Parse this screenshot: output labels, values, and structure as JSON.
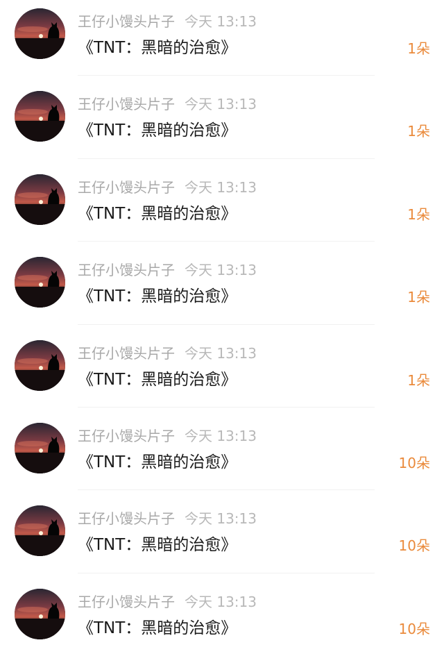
{
  "avatar_icon": "avatar-sunset-silhouette",
  "accent_color": "#ea8a3b",
  "items": [
    {
      "username": "王仔小馒头片子",
      "time": "今天 13:13",
      "title": "《TNT：黑暗的治愈》",
      "count": "1朵"
    },
    {
      "username": "王仔小馒头片子",
      "time": "今天 13:13",
      "title": "《TNT：黑暗的治愈》",
      "count": "1朵"
    },
    {
      "username": "王仔小馒头片子",
      "time": "今天 13:13",
      "title": "《TNT：黑暗的治愈》",
      "count": "1朵"
    },
    {
      "username": "王仔小馒头片子",
      "time": "今天 13:13",
      "title": "《TNT：黑暗的治愈》",
      "count": "1朵"
    },
    {
      "username": "王仔小馒头片子",
      "time": "今天 13:13",
      "title": "《TNT：黑暗的治愈》",
      "count": "1朵"
    },
    {
      "username": "王仔小馒头片子",
      "time": "今天 13:13",
      "title": "《TNT：黑暗的治愈》",
      "count": "10朵"
    },
    {
      "username": "王仔小馒头片子",
      "time": "今天 13:13",
      "title": "《TNT：黑暗的治愈》",
      "count": "10朵"
    },
    {
      "username": "王仔小馒头片子",
      "time": "今天 13:13",
      "title": "《TNT：黑暗的治愈》",
      "count": "10朵"
    }
  ]
}
